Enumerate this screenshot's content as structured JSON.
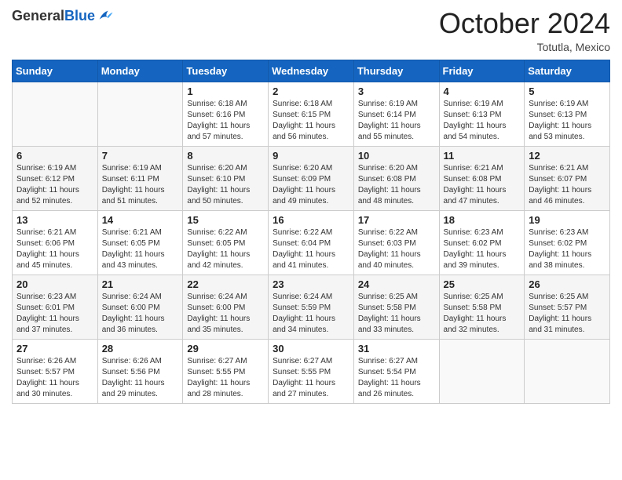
{
  "header": {
    "logo": {
      "general": "General",
      "blue": "Blue"
    },
    "title": "October 2024",
    "location": "Totutla, Mexico"
  },
  "weekdays": [
    "Sunday",
    "Monday",
    "Tuesday",
    "Wednesday",
    "Thursday",
    "Friday",
    "Saturday"
  ],
  "weeks": [
    [
      {
        "day": "",
        "sunrise": "",
        "sunset": "",
        "daylight": ""
      },
      {
        "day": "",
        "sunrise": "",
        "sunset": "",
        "daylight": ""
      },
      {
        "day": "1",
        "sunrise": "Sunrise: 6:18 AM",
        "sunset": "Sunset: 6:16 PM",
        "daylight": "Daylight: 11 hours and 57 minutes."
      },
      {
        "day": "2",
        "sunrise": "Sunrise: 6:18 AM",
        "sunset": "Sunset: 6:15 PM",
        "daylight": "Daylight: 11 hours and 56 minutes."
      },
      {
        "day": "3",
        "sunrise": "Sunrise: 6:19 AM",
        "sunset": "Sunset: 6:14 PM",
        "daylight": "Daylight: 11 hours and 55 minutes."
      },
      {
        "day": "4",
        "sunrise": "Sunrise: 6:19 AM",
        "sunset": "Sunset: 6:13 PM",
        "daylight": "Daylight: 11 hours and 54 minutes."
      },
      {
        "day": "5",
        "sunrise": "Sunrise: 6:19 AM",
        "sunset": "Sunset: 6:13 PM",
        "daylight": "Daylight: 11 hours and 53 minutes."
      }
    ],
    [
      {
        "day": "6",
        "sunrise": "Sunrise: 6:19 AM",
        "sunset": "Sunset: 6:12 PM",
        "daylight": "Daylight: 11 hours and 52 minutes."
      },
      {
        "day": "7",
        "sunrise": "Sunrise: 6:19 AM",
        "sunset": "Sunset: 6:11 PM",
        "daylight": "Daylight: 11 hours and 51 minutes."
      },
      {
        "day": "8",
        "sunrise": "Sunrise: 6:20 AM",
        "sunset": "Sunset: 6:10 PM",
        "daylight": "Daylight: 11 hours and 50 minutes."
      },
      {
        "day": "9",
        "sunrise": "Sunrise: 6:20 AM",
        "sunset": "Sunset: 6:09 PM",
        "daylight": "Daylight: 11 hours and 49 minutes."
      },
      {
        "day": "10",
        "sunrise": "Sunrise: 6:20 AM",
        "sunset": "Sunset: 6:08 PM",
        "daylight": "Daylight: 11 hours and 48 minutes."
      },
      {
        "day": "11",
        "sunrise": "Sunrise: 6:21 AM",
        "sunset": "Sunset: 6:08 PM",
        "daylight": "Daylight: 11 hours and 47 minutes."
      },
      {
        "day": "12",
        "sunrise": "Sunrise: 6:21 AM",
        "sunset": "Sunset: 6:07 PM",
        "daylight": "Daylight: 11 hours and 46 minutes."
      }
    ],
    [
      {
        "day": "13",
        "sunrise": "Sunrise: 6:21 AM",
        "sunset": "Sunset: 6:06 PM",
        "daylight": "Daylight: 11 hours and 45 minutes."
      },
      {
        "day": "14",
        "sunrise": "Sunrise: 6:21 AM",
        "sunset": "Sunset: 6:05 PM",
        "daylight": "Daylight: 11 hours and 43 minutes."
      },
      {
        "day": "15",
        "sunrise": "Sunrise: 6:22 AM",
        "sunset": "Sunset: 6:05 PM",
        "daylight": "Daylight: 11 hours and 42 minutes."
      },
      {
        "day": "16",
        "sunrise": "Sunrise: 6:22 AM",
        "sunset": "Sunset: 6:04 PM",
        "daylight": "Daylight: 11 hours and 41 minutes."
      },
      {
        "day": "17",
        "sunrise": "Sunrise: 6:22 AM",
        "sunset": "Sunset: 6:03 PM",
        "daylight": "Daylight: 11 hours and 40 minutes."
      },
      {
        "day": "18",
        "sunrise": "Sunrise: 6:23 AM",
        "sunset": "Sunset: 6:02 PM",
        "daylight": "Daylight: 11 hours and 39 minutes."
      },
      {
        "day": "19",
        "sunrise": "Sunrise: 6:23 AM",
        "sunset": "Sunset: 6:02 PM",
        "daylight": "Daylight: 11 hours and 38 minutes."
      }
    ],
    [
      {
        "day": "20",
        "sunrise": "Sunrise: 6:23 AM",
        "sunset": "Sunset: 6:01 PM",
        "daylight": "Daylight: 11 hours and 37 minutes."
      },
      {
        "day": "21",
        "sunrise": "Sunrise: 6:24 AM",
        "sunset": "Sunset: 6:00 PM",
        "daylight": "Daylight: 11 hours and 36 minutes."
      },
      {
        "day": "22",
        "sunrise": "Sunrise: 6:24 AM",
        "sunset": "Sunset: 6:00 PM",
        "daylight": "Daylight: 11 hours and 35 minutes."
      },
      {
        "day": "23",
        "sunrise": "Sunrise: 6:24 AM",
        "sunset": "Sunset: 5:59 PM",
        "daylight": "Daylight: 11 hours and 34 minutes."
      },
      {
        "day": "24",
        "sunrise": "Sunrise: 6:25 AM",
        "sunset": "Sunset: 5:58 PM",
        "daylight": "Daylight: 11 hours and 33 minutes."
      },
      {
        "day": "25",
        "sunrise": "Sunrise: 6:25 AM",
        "sunset": "Sunset: 5:58 PM",
        "daylight": "Daylight: 11 hours and 32 minutes."
      },
      {
        "day": "26",
        "sunrise": "Sunrise: 6:25 AM",
        "sunset": "Sunset: 5:57 PM",
        "daylight": "Daylight: 11 hours and 31 minutes."
      }
    ],
    [
      {
        "day": "27",
        "sunrise": "Sunrise: 6:26 AM",
        "sunset": "Sunset: 5:57 PM",
        "daylight": "Daylight: 11 hours and 30 minutes."
      },
      {
        "day": "28",
        "sunrise": "Sunrise: 6:26 AM",
        "sunset": "Sunset: 5:56 PM",
        "daylight": "Daylight: 11 hours and 29 minutes."
      },
      {
        "day": "29",
        "sunrise": "Sunrise: 6:27 AM",
        "sunset": "Sunset: 5:55 PM",
        "daylight": "Daylight: 11 hours and 28 minutes."
      },
      {
        "day": "30",
        "sunrise": "Sunrise: 6:27 AM",
        "sunset": "Sunset: 5:55 PM",
        "daylight": "Daylight: 11 hours and 27 minutes."
      },
      {
        "day": "31",
        "sunrise": "Sunrise: 6:27 AM",
        "sunset": "Sunset: 5:54 PM",
        "daylight": "Daylight: 11 hours and 26 minutes."
      },
      {
        "day": "",
        "sunrise": "",
        "sunset": "",
        "daylight": ""
      },
      {
        "day": "",
        "sunrise": "",
        "sunset": "",
        "daylight": ""
      }
    ]
  ]
}
